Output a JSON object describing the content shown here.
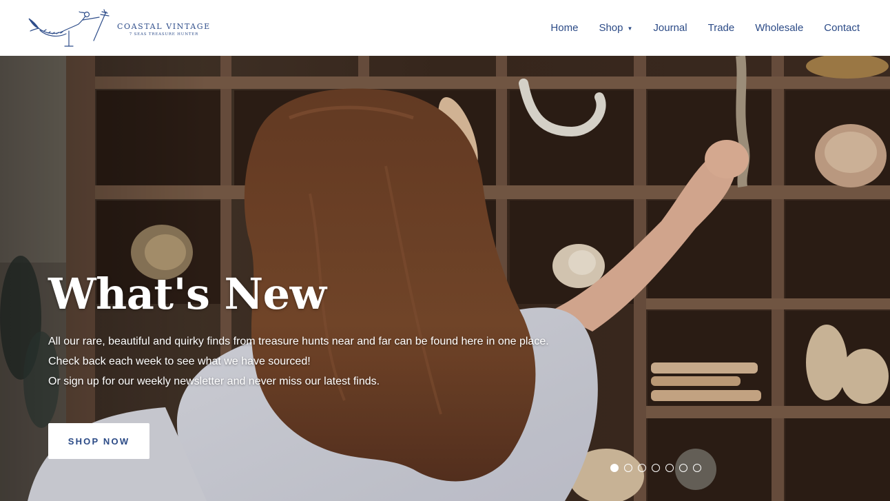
{
  "brand": {
    "name": "COASTAL VINTAGE",
    "tagline": "7 SEAS TREASURE HUNTER",
    "logo_icon": "mermaid-trident-icon",
    "color": "#2b4a86"
  },
  "nav": {
    "items": [
      {
        "label": "Home"
      },
      {
        "label": "Shop",
        "icon": "chevron-down-icon"
      },
      {
        "label": "Journal"
      },
      {
        "label": "Trade"
      },
      {
        "label": "Wholesale"
      },
      {
        "label": "Contact"
      }
    ]
  },
  "hero": {
    "title": "What's New",
    "lines": [
      "All our rare, beautiful and quirky finds from treasure hunts near and far can be found here in one place.",
      "Check back each week to see what we have sourced!",
      "Or sign up for our weekly newsletter and never miss our latest finds."
    ],
    "cta_label": "SHOP NOW",
    "slides_total": 7,
    "active_slide": 1
  }
}
